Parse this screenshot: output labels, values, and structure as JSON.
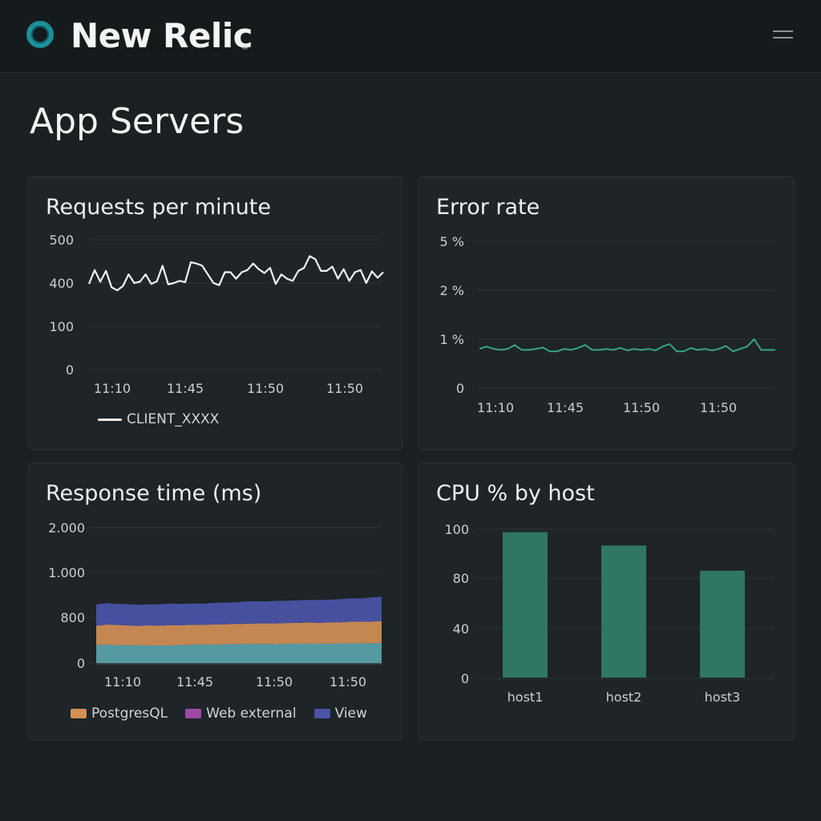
{
  "app": {
    "brand": "New Relic",
    "brand_mark": "®"
  },
  "page": {
    "title": "App Servers"
  },
  "colors": {
    "accent": "#1c8f98",
    "line": "#f1f3f4",
    "error_line": "#3aa483",
    "postgres": "#d49055",
    "web_external": "#9b4aa6",
    "view": "#4a55a8",
    "teal_area": "#5aa4ab",
    "bar": "#2f7762"
  },
  "cards": {
    "requests": {
      "title": "Requests per minute",
      "legend": "CLIENT_XXXX",
      "chart_data": {
        "type": "line",
        "y_tick_labels": [
          "500",
          "400",
          "100",
          "0"
        ],
        "x_tick_labels": [
          "11:10",
          "11:45",
          "11:50",
          "11:50"
        ],
        "series": [
          {
            "name": "CLIENT_XXXX",
            "values": [
              398,
              430,
              403,
              428,
              390,
              383,
              393,
              420,
              400,
              403,
              420,
              398,
              404,
              440,
              397,
              400,
              405,
              402,
              448,
              445,
              440,
              420,
              400,
              395,
              425,
              425,
              410,
              425,
              430,
              445,
              432,
              423,
              435,
              398,
              420,
              410,
              405,
              428,
              435,
              462,
              455,
              428,
              428,
              438,
              410,
              432,
              405,
              425,
              430,
              400,
              427,
              412,
              425
            ]
          }
        ]
      }
    },
    "error_rate": {
      "title": "Error rate",
      "chart_data": {
        "type": "line",
        "y_tick_labels": [
          "5 %",
          "2 %",
          "1 %",
          "0"
        ],
        "x_tick_labels": [
          "11:10",
          "11:45",
          "11:50",
          "11:50"
        ],
        "series": [
          {
            "values": [
              0.8,
              0.85,
              0.8,
              0.78,
              0.8,
              0.88,
              0.78,
              0.78,
              0.8,
              0.83,
              0.75,
              0.75,
              0.8,
              0.78,
              0.82,
              0.88,
              0.78,
              0.78,
              0.8,
              0.78,
              0.82,
              0.77,
              0.8,
              0.78,
              0.8,
              0.77,
              0.85,
              0.9,
              0.75,
              0.75,
              0.82,
              0.78,
              0.8,
              0.77,
              0.8,
              0.86,
              0.75,
              0.8,
              0.85,
              1.0,
              0.78,
              0.78,
              0.78
            ]
          }
        ]
      }
    },
    "response_time": {
      "title": "Response time (ms)",
      "legend": [
        "PostgresQL",
        "Web external",
        "View"
      ],
      "chart_data": {
        "type": "area",
        "y_tick_labels": [
          "2.000",
          "1.000",
          "800",
          "0"
        ],
        "x_tick_labels": [
          "11:10",
          "11:45",
          "11:50",
          "11:50"
        ],
        "stacked": true,
        "series": [
          {
            "name": "teal",
            "values": [
              480,
              490,
              470,
              480,
              470,
              470,
              465,
              470,
              480,
              490,
              495,
              490,
              500,
              505,
              510,
              505,
              510,
              500,
              515,
              510,
              520,
              510,
              515,
              520,
              525,
              520,
              530,
              535
            ]
          },
          {
            "name": "PostgresQL",
            "values": [
              510,
              530,
              540,
              520,
              515,
              530,
              525,
              535,
              520,
              525,
              520,
              530,
              525,
              535,
              530,
              545,
              540,
              550,
              545,
              555,
              560,
              555,
              565,
              560,
              570,
              575,
              570,
              575
            ]
          },
          {
            "name": "View",
            "values": [
              560,
              570,
              560,
              560,
              560,
              555,
              570,
              575,
              570,
              565,
              560,
              575,
              580,
              570,
              590,
              590,
              585,
              600,
              595,
              600,
              595,
              610,
              600,
              615,
              620,
              620,
              640,
              650
            ]
          }
        ]
      }
    },
    "cpu": {
      "title": "CPU % by host",
      "chart_data": {
        "type": "bar",
        "categories": [
          "host1",
          "host2",
          "host3"
        ],
        "values": [
          98,
          89,
          72
        ],
        "y_tick_labels": [
          "100",
          "80",
          "40",
          "0"
        ],
        "ylim": [
          0,
          100
        ]
      }
    }
  }
}
